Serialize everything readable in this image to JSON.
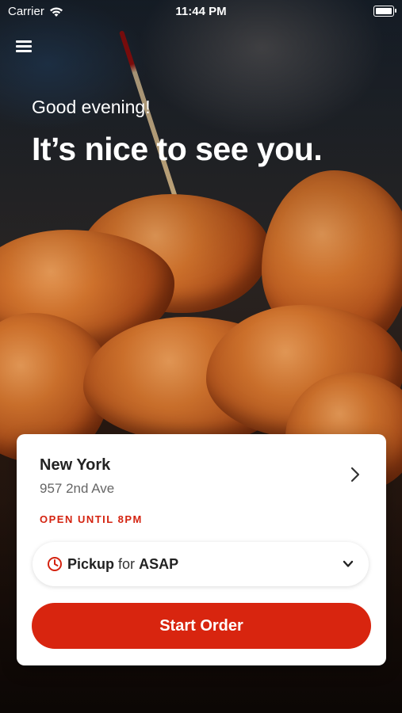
{
  "status_bar": {
    "carrier": "Carrier",
    "time": "11:44 PM"
  },
  "hero": {
    "greeting": "Good evening!",
    "headline": "It’s nice to see you."
  },
  "location": {
    "name": "New York",
    "address": "957 2nd Ave",
    "hours": "OPEN UNTIL 8PM"
  },
  "order_mode": {
    "mode": "Pickup",
    "connector": "for",
    "time": "ASAP"
  },
  "actions": {
    "start_order": "Start Order"
  },
  "colors": {
    "accent": "#d8250f",
    "hours_text": "#d42310"
  },
  "icons": [
    "wifi-icon",
    "battery-icon",
    "menu-icon",
    "chevron-right-icon",
    "clock-icon",
    "chevron-down-icon"
  ]
}
